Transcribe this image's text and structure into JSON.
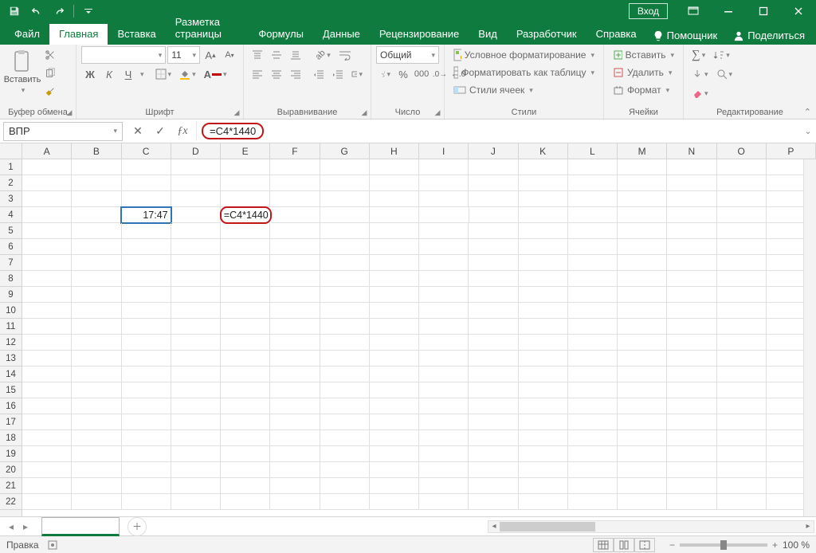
{
  "titlebar": {
    "login": "Вход"
  },
  "tabs": {
    "items": [
      "Файл",
      "Главная",
      "Вставка",
      "Разметка страницы",
      "Формулы",
      "Данные",
      "Рецензирование",
      "Вид",
      "Разработчик",
      "Справка"
    ],
    "active_index": 1,
    "tell_me": "Помощник",
    "share": "Поделиться"
  },
  "ribbon": {
    "clipboard": {
      "paste": "Вставить",
      "label": "Буфер обмена"
    },
    "font": {
      "size": "11",
      "bold": "Ж",
      "italic": "К",
      "underline": "Ч",
      "label": "Шрифт",
      "grow": "A",
      "shrink": "A"
    },
    "align": {
      "label": "Выравнивание"
    },
    "number": {
      "format": "Общий",
      "label": "Число"
    },
    "styles": {
      "cond": "Условное форматирование",
      "table": "Форматировать как таблицу",
      "cell": "Стили ячеек",
      "label": "Стили"
    },
    "cells": {
      "insert": "Вставить",
      "delete": "Удалить",
      "format": "Формат",
      "label": "Ячейки"
    },
    "editing": {
      "label": "Редактирование"
    }
  },
  "fx": {
    "namebox": "ВПР",
    "cancel": "✕",
    "enter": "✓",
    "fx": "ƒx",
    "formula": "=C4*1440"
  },
  "grid": {
    "cols": [
      "A",
      "B",
      "C",
      "D",
      "E",
      "F",
      "G",
      "H",
      "I",
      "J",
      "K",
      "L",
      "M",
      "N",
      "O",
      "P"
    ],
    "rows": 22,
    "c4": "17:47",
    "e4": "=C4*1440"
  },
  "sheets": {
    "active": " "
  },
  "status": {
    "mode": "Правка",
    "zoom": "100 %"
  }
}
